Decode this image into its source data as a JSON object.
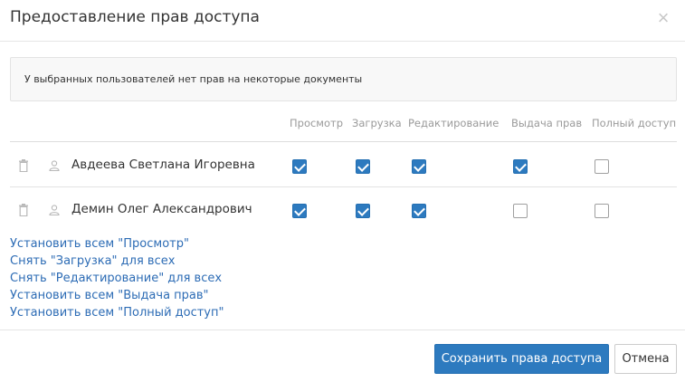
{
  "dialog": {
    "title": "Предоставление прав доступа",
    "close_icon": "close-icon"
  },
  "alert": {
    "text": "У выбранных пользователей нет прав на некоторые документы"
  },
  "columns": [
    "Просмотр",
    "Загрузка",
    "Редактирование",
    "Выдача прав",
    "Полный доступ"
  ],
  "users": [
    {
      "name": "Авдеева Светлана Игоревна",
      "permissions": [
        true,
        true,
        true,
        true,
        false
      ]
    },
    {
      "name": "Демин Олег Александрович",
      "permissions": [
        true,
        true,
        true,
        false,
        false
      ]
    }
  ],
  "bulk_actions": [
    "Установить всем \"Просмотр\"",
    "Снять \"Загрузка\" для всех",
    "Снять \"Редактирование\" для всех",
    "Установить всем \"Выдача прав\"",
    "Установить всем \"Полный доступ\""
  ],
  "footer": {
    "save_label": "Сохранить права доступа",
    "cancel_label": "Отмена"
  },
  "colors": {
    "accent": "#2d7abf",
    "link": "#2d6cb5"
  },
  "icons": {
    "row_delete": "trash-icon",
    "row_user": "user-icon"
  }
}
